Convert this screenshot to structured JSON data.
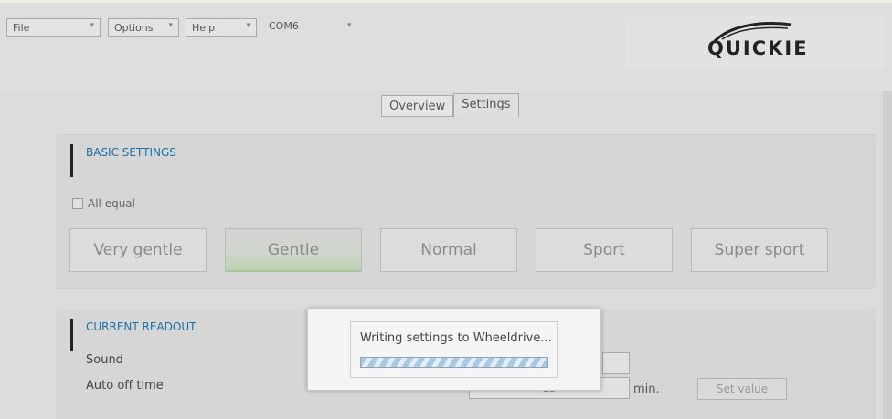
{
  "menubar": {
    "file": "File",
    "options": "Options",
    "help": "Help",
    "port": "COM6"
  },
  "logo": {
    "text": "QUICKIE"
  },
  "tabs": [
    {
      "label": "Overview",
      "active": false
    },
    {
      "label": "Settings",
      "active": true
    }
  ],
  "basic_settings": {
    "title": "BASIC SETTINGS",
    "all_equal_label": "All equal",
    "all_equal_checked": false,
    "profiles": [
      "Very gentle",
      "Gentle",
      "Normal",
      "Sport",
      "Super sport"
    ],
    "selected_profile": "Gentle"
  },
  "current_readout": {
    "title": "CURRENT READOUT",
    "sound_label": "Sound",
    "sound_value": "",
    "auto_off_label": "Auto off time",
    "auto_off_value": "15",
    "auto_off_unit": "min.",
    "set_value_label": "Set value"
  },
  "dialog": {
    "message": "Writing settings to Wheeldrive...",
    "progress": "indeterminate"
  },
  "colors": {
    "section_title": "#1d6fa5",
    "selected_profile_accent": "#a7c79a",
    "progress_stripe": "#a9c8e4"
  }
}
